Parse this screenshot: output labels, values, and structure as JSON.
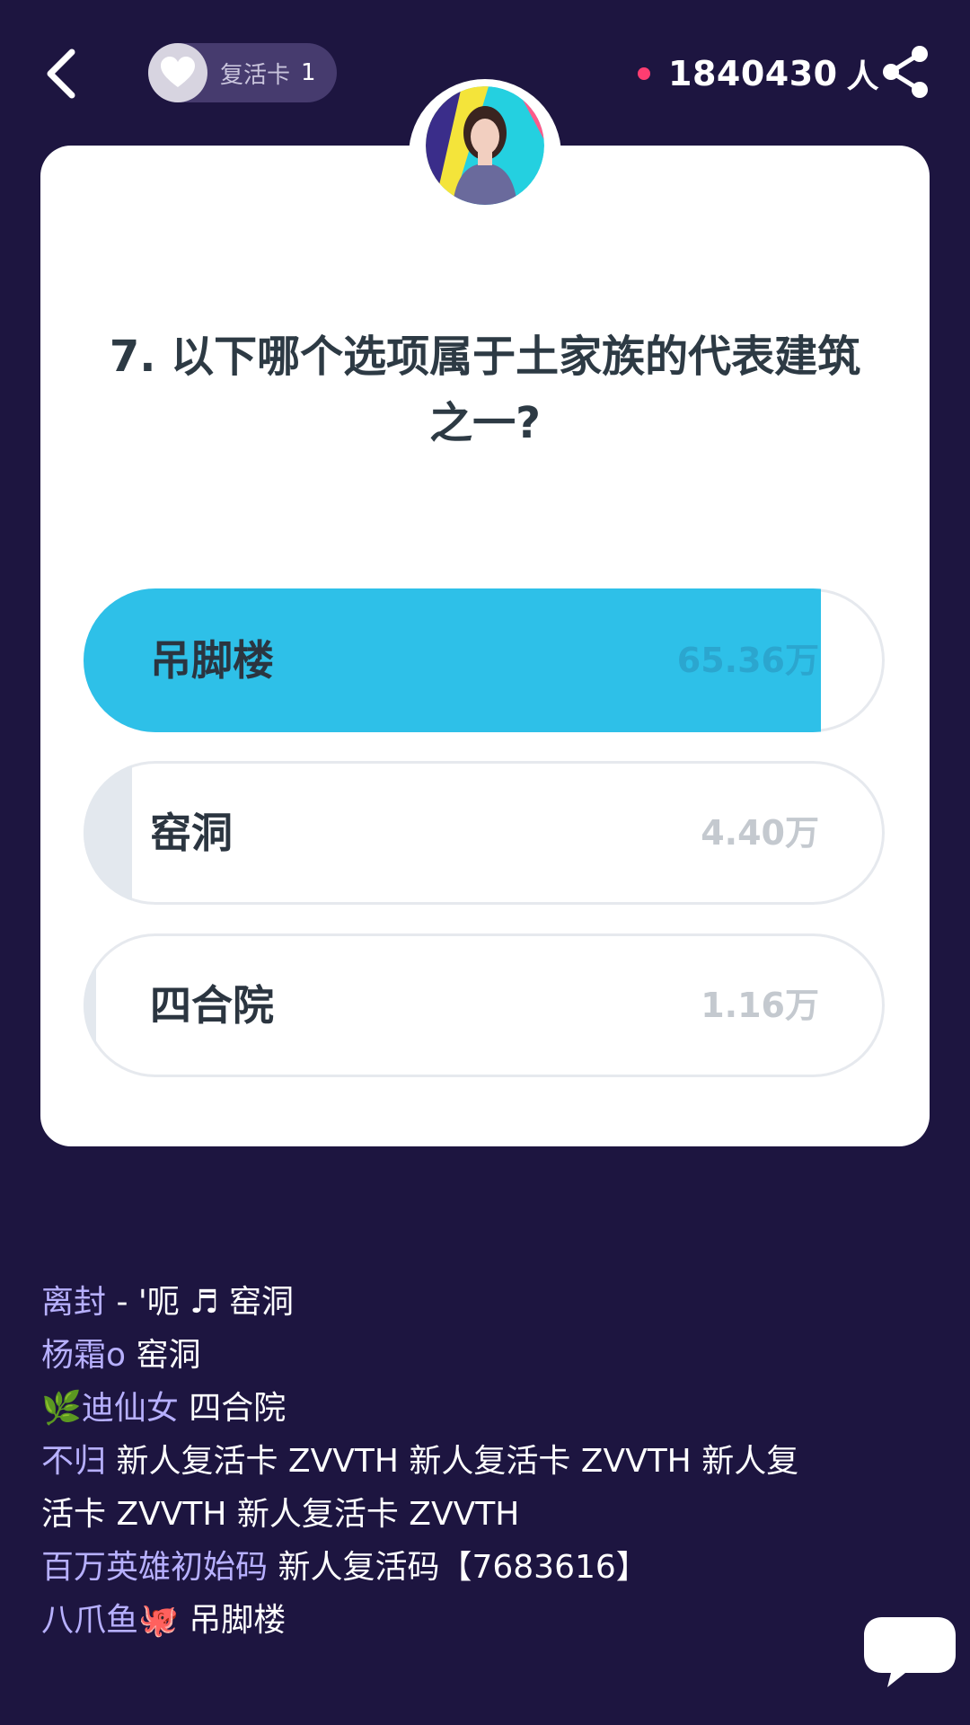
{
  "header": {
    "revive_label": "复活卡",
    "revive_count": "1",
    "online_count": "1840430",
    "online_unit": "人"
  },
  "question": {
    "text": "7. 以下哪个选项属于土家族的代表建筑之一?"
  },
  "options": [
    {
      "label": "吊脚楼",
      "count": "65.36万",
      "fraction": 0.92,
      "correct": true
    },
    {
      "label": "窑洞",
      "count": "4.40万",
      "fraction": 0.06,
      "correct": false
    },
    {
      "label": "四合院",
      "count": "1.16万",
      "fraction": 0.016,
      "correct": false
    }
  ],
  "colors": {
    "background": "#1d1540",
    "correct_fill": "#2ec0e8",
    "wrong_fill": "#e3e8ee",
    "chat_name": "#b7b0ff"
  },
  "chat": [
    {
      "name": "离封",
      "msg": "- '呃   ♬ 窑洞",
      "faded": true
    },
    {
      "name": "杨霜o",
      "msg": "窑洞"
    },
    {
      "name": "🌿迪仙女",
      "msg": "四合院"
    },
    {
      "name": "不归",
      "msg": "新人复活卡  ZVVTH   新人复活卡  ZVVTH  新人复活卡  ZVVTH   新人复活卡  ZVVTH",
      "wrap": true
    },
    {
      "name": "百万英雄初始码",
      "msg": "新人复活码【7683616】"
    },
    {
      "name": "八爪鱼🐙",
      "msg": "吊脚楼"
    }
  ],
  "icons": {
    "back": "chevron-left-icon",
    "heart": "heart-icon",
    "share": "share-icon",
    "chat": "chat-bubble-icon"
  }
}
